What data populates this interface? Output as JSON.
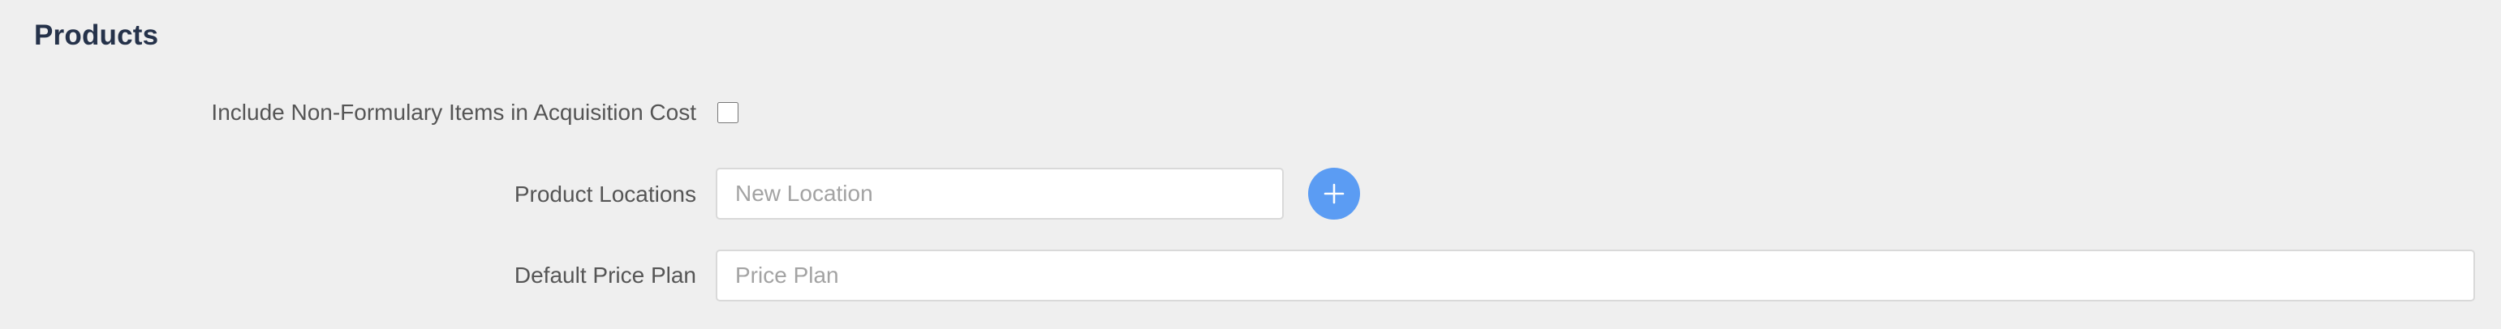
{
  "section": {
    "title": "Products"
  },
  "form": {
    "non_formulary": {
      "label": "Include Non-Formulary Items in Acquisition Cost",
      "checked": false
    },
    "product_locations": {
      "label": "Product Locations",
      "placeholder": "New Location",
      "value": "",
      "add_button_icon": "plus-icon"
    },
    "default_price_plan": {
      "label": "Default Price Plan",
      "placeholder": "Price Plan",
      "value": ""
    }
  },
  "colors": {
    "background": "#efefef",
    "title": "#25324a",
    "accent": "#5b9cf3"
  }
}
